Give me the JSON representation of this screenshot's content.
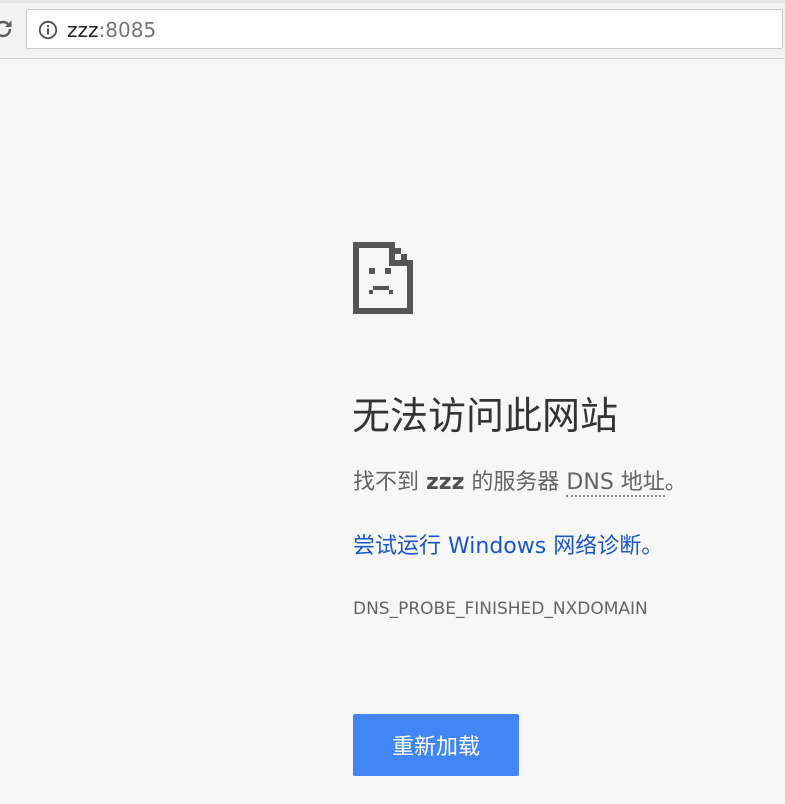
{
  "browser": {
    "address_bar": {
      "host": "zzz",
      "port": ":8085",
      "security_icon": "info-icon"
    },
    "reload_icon": "reload-icon"
  },
  "error_page": {
    "icon": "sad-file-icon",
    "heading": "无法访问此网站",
    "summary": {
      "prefix": "找不到 ",
      "domain": "zzz",
      "middle": " 的服务器 ",
      "dns_term": "DNS 地址",
      "suffix": "。"
    },
    "suggestion": {
      "link_text": "尝试运行 Windows 网络诊断",
      "suffix": "。"
    },
    "error_code": "DNS_PROBE_FINISHED_NXDOMAIN",
    "reload_button_label": "重新加载"
  },
  "colors": {
    "background": "#f7f7f7",
    "link": "#1a57c6",
    "button": "#4285f4",
    "text": "#646464",
    "heading": "#333333"
  }
}
